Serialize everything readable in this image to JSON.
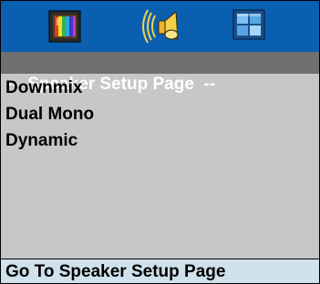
{
  "toolbar": {
    "tabs": [
      {
        "icon": "tv-color-bars-icon"
      },
      {
        "icon": "speaker-icon",
        "active": true
      },
      {
        "icon": "preference-panel-icon"
      }
    ]
  },
  "header": {
    "title": "--  Speaker Setup Page  --"
  },
  "menu": {
    "items": [
      {
        "label": "Downmix"
      },
      {
        "label": "Dual Mono"
      },
      {
        "label": "Dynamic"
      }
    ]
  },
  "status": {
    "text": "Go To Speaker Setup Page"
  },
  "colors": {
    "icon_bar": "#0a5fb0",
    "title_bar": "#6f6f6f",
    "body": "#c6c7c7",
    "status_bar": "#cfe1ec"
  }
}
